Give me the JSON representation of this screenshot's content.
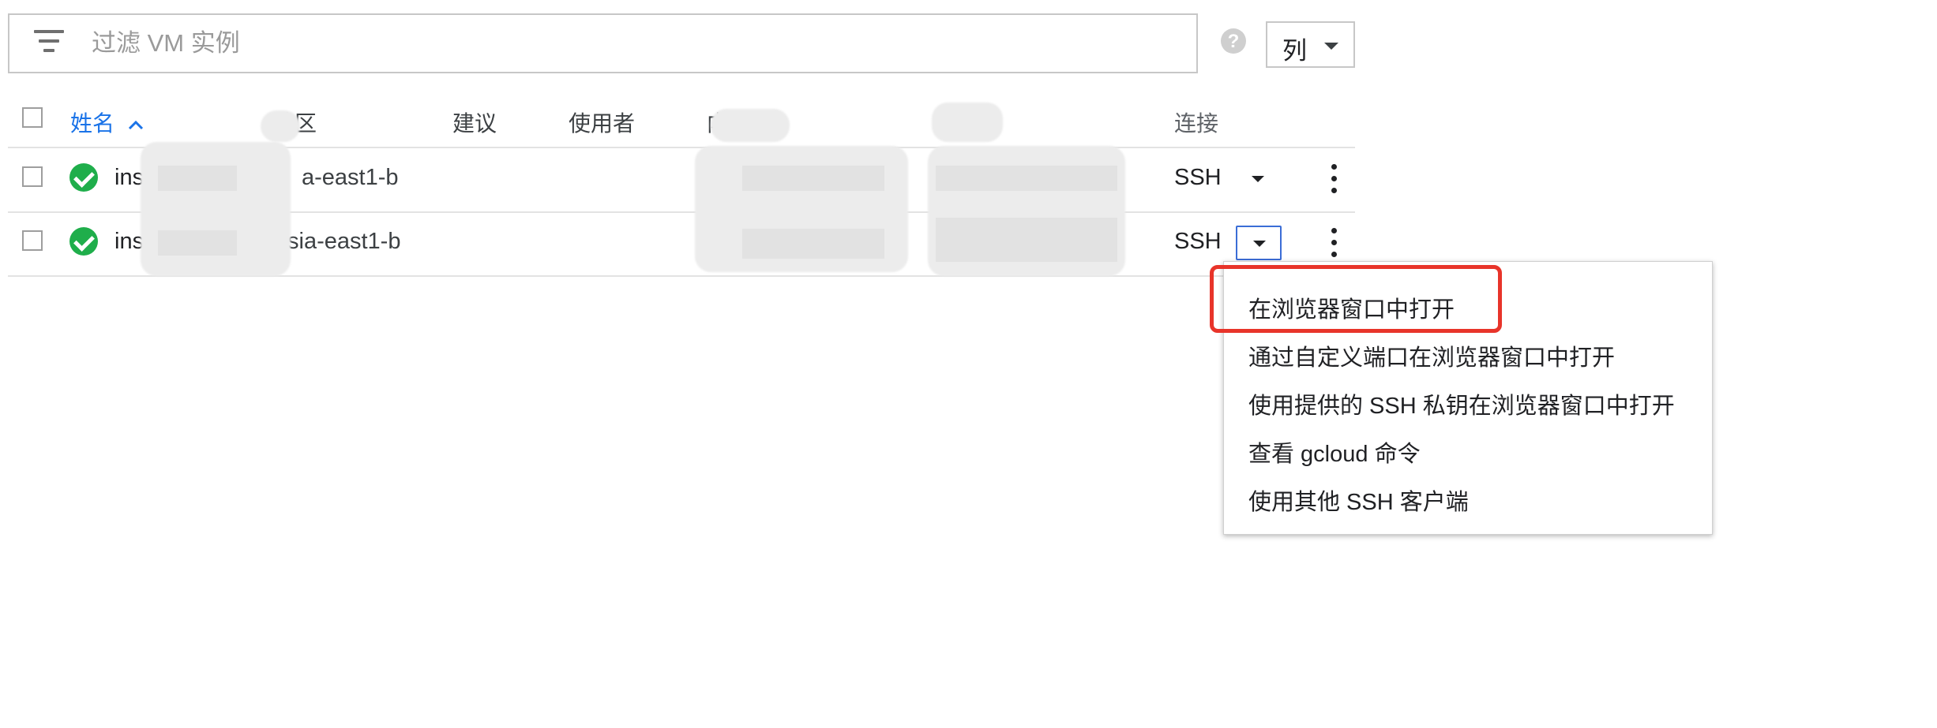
{
  "filter": {
    "placeholder": "过滤 VM 实例"
  },
  "help": {
    "glyph": "?"
  },
  "columns_button": {
    "label": "列"
  },
  "table": {
    "headers": {
      "name": "姓名",
      "zone": "地区",
      "recommendation": "建议",
      "used_by": "使用者",
      "internal_ip": "内",
      "connect": "连接"
    },
    "sort": {
      "column": "name",
      "direction": "ascending"
    },
    "rows": [
      {
        "name_visible": "insta",
        "zone_visible": "a-east1-b",
        "status": "running",
        "connect": "SSH"
      },
      {
        "name_visible": "ins",
        "zone_visible": "sia-east1-b",
        "status": "running",
        "connect": "SSH"
      }
    ]
  },
  "ssh_menu": {
    "items": [
      "在浏览器窗口中打开",
      "通过自定义端口在浏览器窗口中打开",
      "使用提供的 SSH 私钥在浏览器窗口中打开",
      "查看 gcloud 命令",
      "使用其他 SSH 客户端"
    ],
    "highlighted_index": 0
  },
  "colors": {
    "accent": "#1a73e8",
    "status_ok": "#1fae4b",
    "highlight": "#e8342a",
    "dropdown_focus": "#3b6dd6"
  }
}
